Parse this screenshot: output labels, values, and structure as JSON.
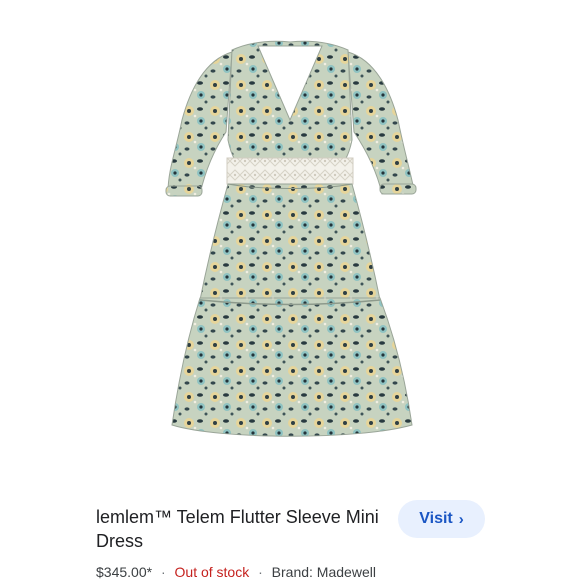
{
  "product": {
    "image_alt": "lemlem Telem Flutter Sleeve Mini Dress product photo",
    "title": "lemlem™ Telem Flutter Sleeve Mini Dress",
    "visit_label": "Visit",
    "visit_icon": "chevron-right-icon",
    "price": "$345.00*",
    "stock_status": "Out of stock",
    "brand": "Brand: Madewell",
    "separator": "·"
  },
  "colors": {
    "button_bg": "#e8f0fe",
    "button_text": "#1a56c4",
    "out_of_stock": "#c5221f"
  }
}
